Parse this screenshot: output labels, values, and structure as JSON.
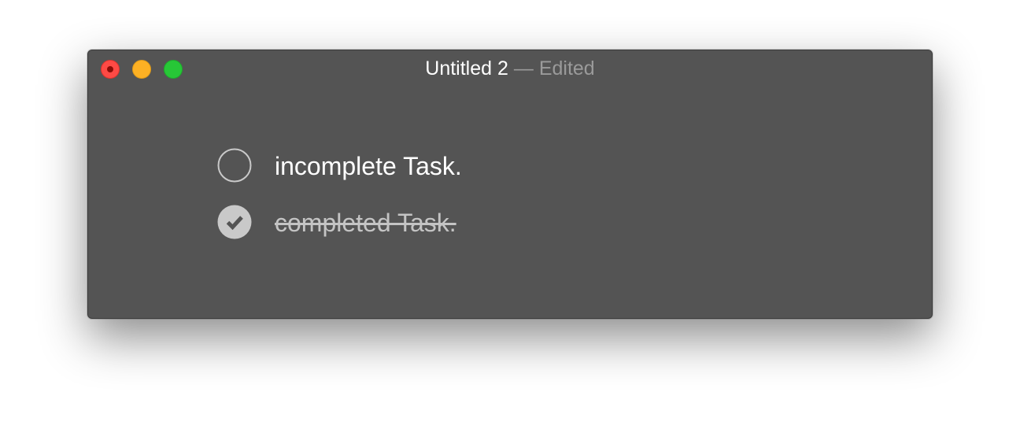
{
  "window": {
    "title": "Untitled 2",
    "separator": "—",
    "status": "Edited",
    "controls": [
      "close",
      "minimize",
      "zoom"
    ]
  },
  "colors": {
    "window_bg": "#545454",
    "close": "#fe4a45",
    "minimize": "#fdb124",
    "zoom": "#27c737",
    "completed_text": "#c4c4c4"
  },
  "tasks": [
    {
      "label": "incomplete Task.",
      "completed": false,
      "icon": "empty-circle-icon"
    },
    {
      "label": "completed Task.",
      "completed": true,
      "icon": "checkmark-circle-icon"
    }
  ]
}
